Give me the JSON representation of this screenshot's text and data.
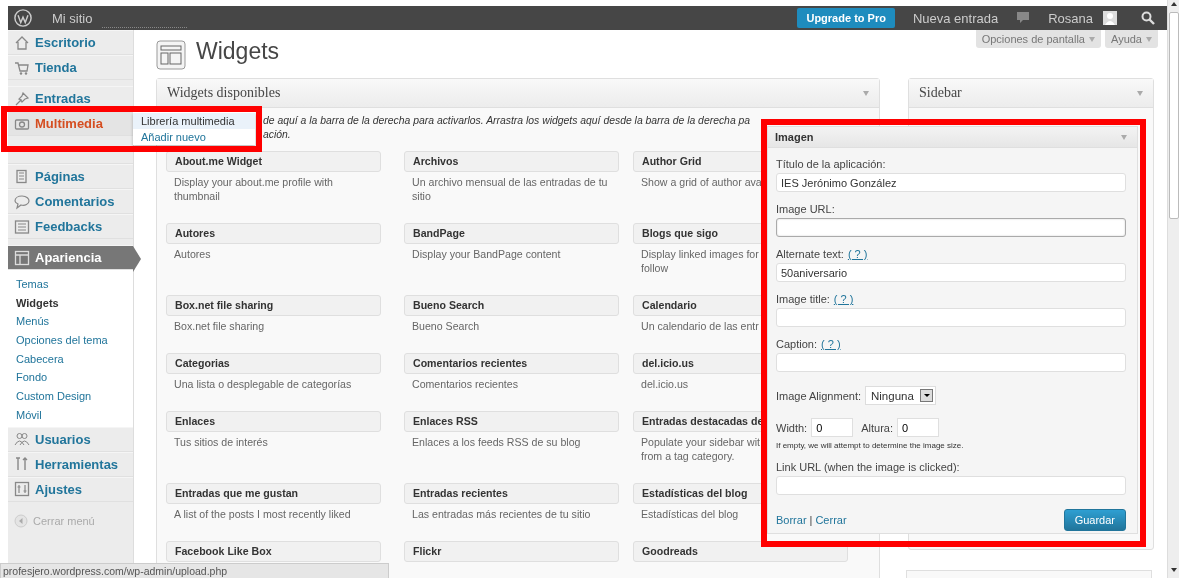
{
  "top_bar": {
    "site_name": "Mi sitio",
    "upgrade_button": "Upgrade to Pro",
    "new_post": "Nueva entrada",
    "user_name": "Rosana"
  },
  "screen_tabs": [
    {
      "label": "Opciones de pantalla"
    },
    {
      "label": "Ayuda"
    }
  ],
  "menu": [
    {
      "kind": "item",
      "label": "Escritorio",
      "selected": false,
      "open": false
    },
    {
      "kind": "item",
      "label": "Tienda",
      "selected": false,
      "open": false
    },
    {
      "kind": "separator"
    },
    {
      "kind": "item",
      "label": "Entradas",
      "selected": false,
      "open": false
    },
    {
      "kind": "item",
      "label": "Multimedia",
      "selected": false,
      "open": true,
      "submenu": [
        {
          "label": "Librería multimedia",
          "selected": true
        },
        {
          "label": "Añadir nuevo",
          "selected": false
        }
      ]
    },
    {
      "kind": "item",
      "label": "Páginas",
      "selected": false,
      "open": false
    },
    {
      "kind": "item",
      "label": "Comentarios",
      "selected": false,
      "open": false
    },
    {
      "kind": "item",
      "label": "Feedbacks",
      "selected": false,
      "open": false
    },
    {
      "kind": "separator"
    },
    {
      "kind": "item",
      "label": "Apariencia",
      "selected": true,
      "open": false,
      "children": [
        {
          "label": "Temas",
          "selected": false
        },
        {
          "label": "Widgets",
          "selected": true
        },
        {
          "label": "Menús",
          "selected": false
        },
        {
          "label": "Opciones del tema",
          "selected": false
        },
        {
          "label": "Cabecera",
          "selected": false
        },
        {
          "label": "Fondo",
          "selected": false
        },
        {
          "label": "Custom Design",
          "selected": false
        },
        {
          "label": "Móvil",
          "selected": false
        }
      ]
    },
    {
      "kind": "item",
      "label": "Usuarios",
      "selected": false,
      "open": false
    },
    {
      "kind": "item",
      "label": "Herramientas",
      "selected": false,
      "open": false
    },
    {
      "kind": "item",
      "label": "Ajustes",
      "selected": false,
      "open": false
    }
  ],
  "collapse_menu": "Cerrar menú",
  "page_title": "Widgets",
  "available_widgets": {
    "title": "Widgets disponibles",
    "description_lines": [
      "de aquí a la barra de la derecha para activarlos. Arrastra los widgets aquí desde la barra de la derecha pa",
      "ación."
    ],
    "widgets": [
      {
        "title": "About.me Widget",
        "description": "Display your about.me profile with thumbnail"
      },
      {
        "title": "Archivos",
        "description": "Un archivo mensual de las entradas de tu sitio"
      },
      {
        "title": "Author Grid",
        "description": "Show a grid of author ava"
      },
      {
        "title": "Autores",
        "description": "Autores"
      },
      {
        "title": "BandPage",
        "description": "Display your BandPage content"
      },
      {
        "title": "Blogs que sigo",
        "description": "Display linked images for\nfollow"
      },
      {
        "title": "Box.net file sharing",
        "description": "Box.net file sharing"
      },
      {
        "title": "Bueno Search",
        "description": "Bueno Search"
      },
      {
        "title": "Calendario",
        "description": "Un calendario de las entr"
      },
      {
        "title": "Categorias",
        "description": "Una lista o desplegable de categorías"
      },
      {
        "title": "Comentarios recientes",
        "description": "Comentarios recientes"
      },
      {
        "title": "del.icio.us",
        "description": "del.icio.us"
      },
      {
        "title": "Enlaces",
        "description": "Tus sitios de interés"
      },
      {
        "title": "Enlaces RSS",
        "description": "Enlaces a los feeds RSS de su blog"
      },
      {
        "title": "Entradas destacadas de",
        "description": "Populate your sidebar wit\nfrom a tag category."
      },
      {
        "title": "Entradas que me gustan",
        "description": "A list of the posts I most recently liked"
      },
      {
        "title": "Entradas recientes",
        "description": "Las entradas más recientes de tu sitio"
      },
      {
        "title": "Estadísticas del blog",
        "description": "Estadísticas del blog"
      },
      {
        "title": "Facebook Like Box"
      },
      {
        "title": "Flickr"
      },
      {
        "title": "Goodreads"
      }
    ]
  },
  "sidebar_panel": {
    "title": "Sidebar"
  },
  "widget_form": {
    "title": "Imagen",
    "fields": [
      {
        "kind": "text",
        "label": "Título de la aplicación:",
        "value": "IES Jerónimo González",
        "focused": false
      },
      {
        "kind": "text",
        "label": "Image URL:",
        "focused": true
      },
      {
        "kind": "text",
        "label": "Alternate text:",
        "help": "( ? )",
        "value": "50aniversario",
        "focused": false
      },
      {
        "kind": "text",
        "label": "Image title:",
        "help": "( ? )",
        "focused": false
      },
      {
        "kind": "text",
        "label": "Caption:",
        "help": "( ? )",
        "focused": false
      },
      {
        "kind": "select",
        "label": "Image Alignment:",
        "value": "Ninguna"
      },
      {
        "kind": "size",
        "label": "Width:",
        "value": "0",
        "second_label": "Altura:",
        "second_value": "0",
        "hint": "If empty, we will attempt to determine the image size."
      },
      {
        "kind": "text",
        "label": "Link URL (when the image is clicked):",
        "focused": false
      }
    ],
    "delete_link": "Borrar",
    "separator": "|",
    "close_link": "Cerrar",
    "save_button": "Guardar"
  },
  "status_bar": "profesjero.wordpress.com/wp-admin/upload.php"
}
